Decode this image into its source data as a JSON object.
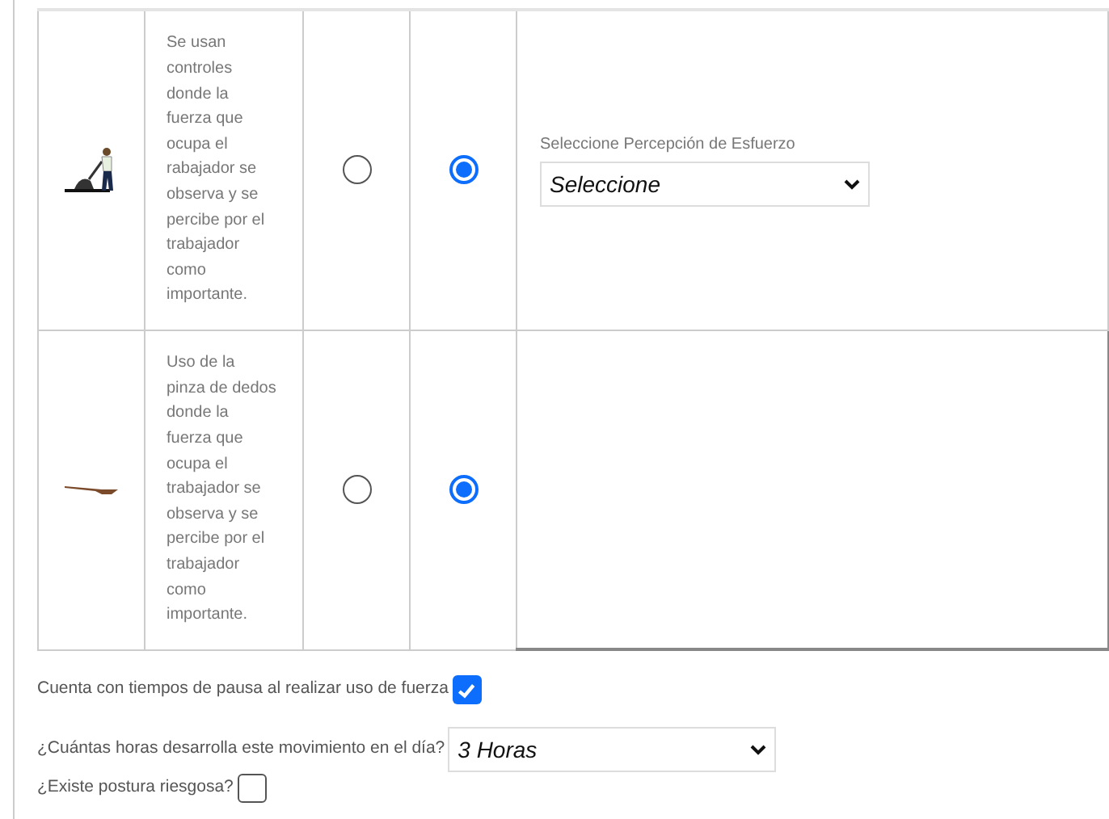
{
  "rows": [
    {
      "kind": "worker",
      "description": "Se usan controles donde la fuerza que ocupa el rabajador se observa y se percibe por el trabajador como importante.",
      "options": [
        {
          "selected": false
        },
        {
          "selected": true
        }
      ],
      "effort": {
        "label": "Seleccione Percepción de Esfuerzo",
        "value": "Seleccione"
      }
    },
    {
      "kind": "tool",
      "description": "Uso de la pinza de dedos donde la fuerza que ocupa el trabajador se observa y se percibe por el trabajador como importante.",
      "options": [
        {
          "selected": false
        },
        {
          "selected": true
        }
      ]
    }
  ],
  "pause": {
    "label": "Cuenta con tiempos de pausa al realizar uso de fuerza",
    "checked": true
  },
  "hours": {
    "label": "¿Cuántas horas desarrolla este movimiento en el día?",
    "value": "3 Horas"
  },
  "posture": {
    "label": "¿Existe postura riesgosa?",
    "checked": false
  }
}
